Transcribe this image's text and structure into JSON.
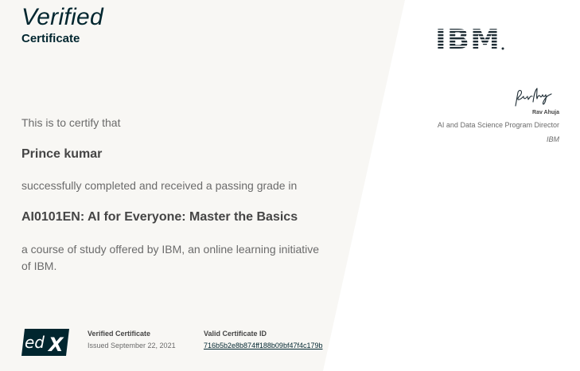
{
  "header": {
    "verified": "Verified",
    "certificate": "Certificate"
  },
  "body": {
    "certify": "This is to certify that",
    "recipient": "Prince kumar",
    "completed": "successfully completed and received a passing grade in",
    "course": "AI0101EN: AI for Everyone: Master the Basics",
    "offered": "a course of study offered by IBM, an online learning initiative of IBM."
  },
  "footer": {
    "logo": "edX",
    "vc_label": "Verified Certificate",
    "issued": "Issued September 22, 2021",
    "id_label": "Valid Certificate ID",
    "id_value": "716b5b2e8b874ff188b09bf47f4c179b"
  },
  "issuer": {
    "logo": "IBM",
    "signatory_name": "Rav Ahuja",
    "signatory_title": "AI and Data Science Program Director",
    "signatory_org": "IBM"
  },
  "colors": {
    "panel": "#f8f7f4",
    "brand_dark": "#01262f",
    "text_dark": "#454545",
    "text_muted": "#6b6b6b",
    "ibm": "#1f2d35"
  }
}
